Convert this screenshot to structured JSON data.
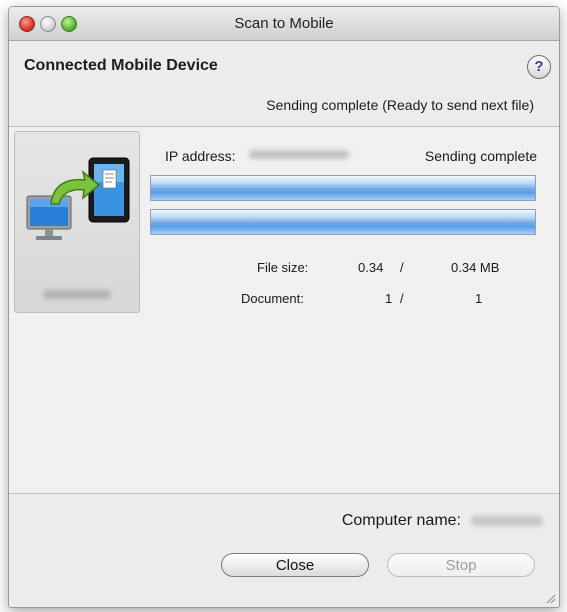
{
  "window": {
    "title": "Scan to Mobile"
  },
  "header": {
    "title": "Connected Mobile Device",
    "help_label": "?"
  },
  "status_message": "Sending complete (Ready to send next file)",
  "device": {
    "ip_label": "IP address:",
    "status": "Sending complete"
  },
  "progress": {
    "bar1": 1.0,
    "bar2": 1.0
  },
  "stats": {
    "file_size_label": "File size:",
    "file_size_sent": "0.34",
    "file_size_sep": "/",
    "file_size_total": "0.34 MB",
    "document_label": "Document:",
    "document_sent": "1",
    "document_sep": "/",
    "document_total": "1"
  },
  "footer": {
    "computer_name_label": "Computer name:"
  },
  "buttons": {
    "close": "Close",
    "stop": "Stop"
  },
  "colors": {
    "progress_fill": "#5b9ee6",
    "help_question": "#5a2d8a",
    "window_bg": "#ececec"
  },
  "icons": [
    "computer-to-tablet-icon",
    "help-icon",
    "resize-grip-icon"
  ]
}
